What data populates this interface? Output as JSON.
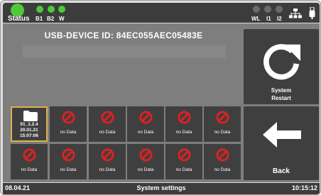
{
  "status_bar": {
    "status_label": "Status",
    "status_color": "#4dc93a",
    "leds_left": [
      {
        "label": "B1",
        "color": "#4dc93a"
      },
      {
        "label": "B2",
        "color": "#4dc93a"
      },
      {
        "label": "W",
        "color": "#4dc93a"
      }
    ],
    "leds_right": [
      {
        "label": "WL",
        "color": "#6a6a6a"
      },
      {
        "label": "I1",
        "color": "#6a6a6a"
      },
      {
        "label": "I2",
        "color": "#6a6a6a"
      }
    ],
    "network_icon": "network-icon",
    "usb_icon": "usb-icon"
  },
  "device": {
    "id_text": "USB-DEVICE ID: 84EC055AEC05483E"
  },
  "slots": {
    "row1": [
      {
        "type": "folder",
        "line1": "01_1.2.4",
        "line2": "20.01.21",
        "line3": "15:07:06",
        "selected": true
      },
      {
        "type": "empty",
        "label": "no Data"
      },
      {
        "type": "empty",
        "label": "no Data"
      },
      {
        "type": "empty",
        "label": "no Data"
      },
      {
        "type": "empty",
        "label": "no Data"
      },
      {
        "type": "empty",
        "label": "no Data"
      }
    ],
    "row2": [
      {
        "type": "empty",
        "label": "no Data"
      },
      {
        "type": "empty",
        "label": "no Data"
      },
      {
        "type": "empty",
        "label": "no Data"
      },
      {
        "type": "empty",
        "label": "no Data"
      },
      {
        "type": "empty",
        "label": "no Data"
      },
      {
        "type": "empty",
        "label": "no Data"
      }
    ]
  },
  "buttons": {
    "restart_line1": "System",
    "restart_line2": "Restart",
    "back_label": "Back"
  },
  "footer": {
    "date": "08.04.21",
    "title": "System settings",
    "time": "10:15:12"
  },
  "colors": {
    "accent_selected": "#d9b24a",
    "no_data_icon": "#e02020"
  }
}
